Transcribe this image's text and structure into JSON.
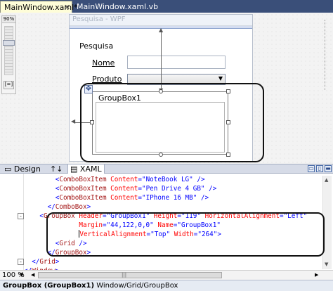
{
  "tabs": [
    {
      "label": "MainWindow.xaml*",
      "active": true
    },
    {
      "label": "MainWindow.xaml.vb",
      "active": false
    }
  ],
  "icons": {
    "tab_close": "close-icon",
    "move": "move-icon",
    "swap": "swap-icon",
    "xaml_file": "xaml-file-icon"
  },
  "zoom_slider": {
    "percent": "90%",
    "fit": "[=]"
  },
  "wpf_window": {
    "title": "Pesquisa - WPF",
    "heading": "Pesquisa",
    "nome_label": "Nome",
    "produto_label": "Produto",
    "groupbox_header": "GroupBox1"
  },
  "split_bar": {
    "design_tab": "Design",
    "swap_symbol": "↑↓",
    "xaml_tab": "XAML"
  },
  "code_lines": [
    {
      "indent": "        ",
      "text": "<ComboBoxItem Content=\"NoteBook LG\" />"
    },
    {
      "indent": "        ",
      "text": "<ComboBoxItem Content=\"Pen Drive 4 GB\" />"
    },
    {
      "indent": "        ",
      "text": "<ComboBoxItem Content=\"IPhone 16 MB\" />"
    },
    {
      "indent": "      ",
      "text": "</ComboBox>"
    },
    {
      "indent": "    ",
      "text": "<GroupBox Header=\"GroupBox1\" Height=\"119\" HorizontalAlignment=\"Left\""
    },
    {
      "indent": "              ",
      "text": "Margin=\"44,122,0,0\" Name=\"GroupBox1\""
    },
    {
      "indent": "              ",
      "text": "VerticalAlignment=\"Top\" Width=\"264\">"
    },
    {
      "indent": "        ",
      "text": "<Grid />"
    },
    {
      "indent": "      ",
      "text": "</GroupBox>"
    },
    {
      "indent": "  ",
      "text": "</Grid>"
    },
    {
      "indent": "",
      "text": "</Window>"
    }
  ],
  "status": {
    "zoom_level": "100 %"
  },
  "breadcrumb": {
    "selected": "GroupBox (GroupBox1)",
    "path": "Window/Grid/GroupBox"
  }
}
